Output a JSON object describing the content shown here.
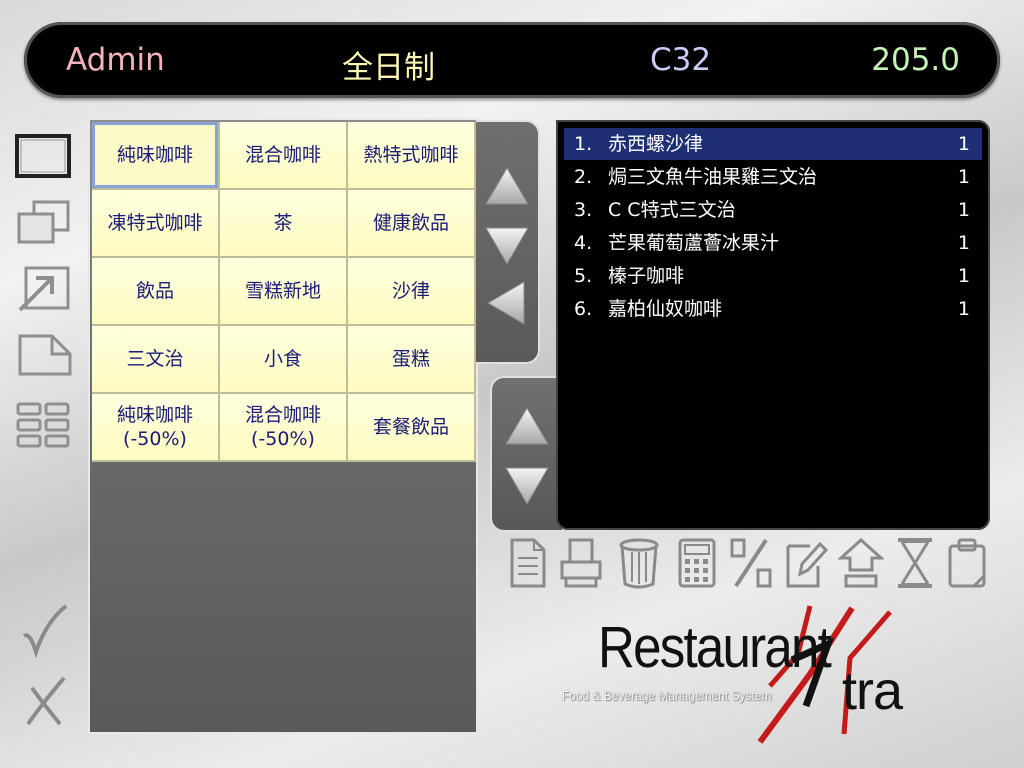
{
  "header": {
    "user": "Admin",
    "mode": "全日制",
    "table": "C32",
    "total": "205.0",
    "colors": {
      "user": "#f3b3b8",
      "mode": "#fdf7b5",
      "table": "#c9ccf6",
      "total": "#c5f3b5"
    }
  },
  "sidebar": {
    "icons": [
      "single-window-icon",
      "multi-window-icon",
      "transfer-arrow-icon",
      "tag-window-icon",
      "grid-view-icon"
    ],
    "confirm_icon": "check-icon",
    "cancel_icon": "cross-icon"
  },
  "categories": [
    "純味咖啡",
    "混合咖啡",
    "熱特式咖啡",
    "凍特式咖啡",
    "茶",
    "健康飲品",
    "飲品",
    "雪糕新地",
    "沙律",
    "三文治",
    "小食",
    "蛋糕",
    "純味咖啡 (-50%)",
    "混合咖啡 (-50%)",
    "套餐飲品"
  ],
  "selected_category": 0,
  "order": {
    "selected_index": 0,
    "items": [
      {
        "num": "1.",
        "name": "赤西螺沙律",
        "qty": "1"
      },
      {
        "num": "2.",
        "name": "焗三文魚牛油果雞三文治",
        "qty": "1"
      },
      {
        "num": "3.",
        "name": "C C特式三文治",
        "qty": "1"
      },
      {
        "num": "4.",
        "name": "芒果葡萄蘆薈冰果汁",
        "qty": "1"
      },
      {
        "num": "5.",
        "name": "榛子咖啡",
        "qty": "1"
      },
      {
        "num": "6.",
        "name": "嘉柏仙奴咖啡",
        "qty": "1"
      }
    ]
  },
  "toolbar": {
    "icons": [
      "document-icon",
      "printer-icon",
      "trash-icon",
      "calculator-icon",
      "percent-icon",
      "edit-icon",
      "home-up-icon",
      "hourglass-icon",
      "clipboard-icon"
    ]
  },
  "logo": {
    "main": "Restaurant",
    "xtra": "tra",
    "sub": "Food & Beverage Management System"
  }
}
